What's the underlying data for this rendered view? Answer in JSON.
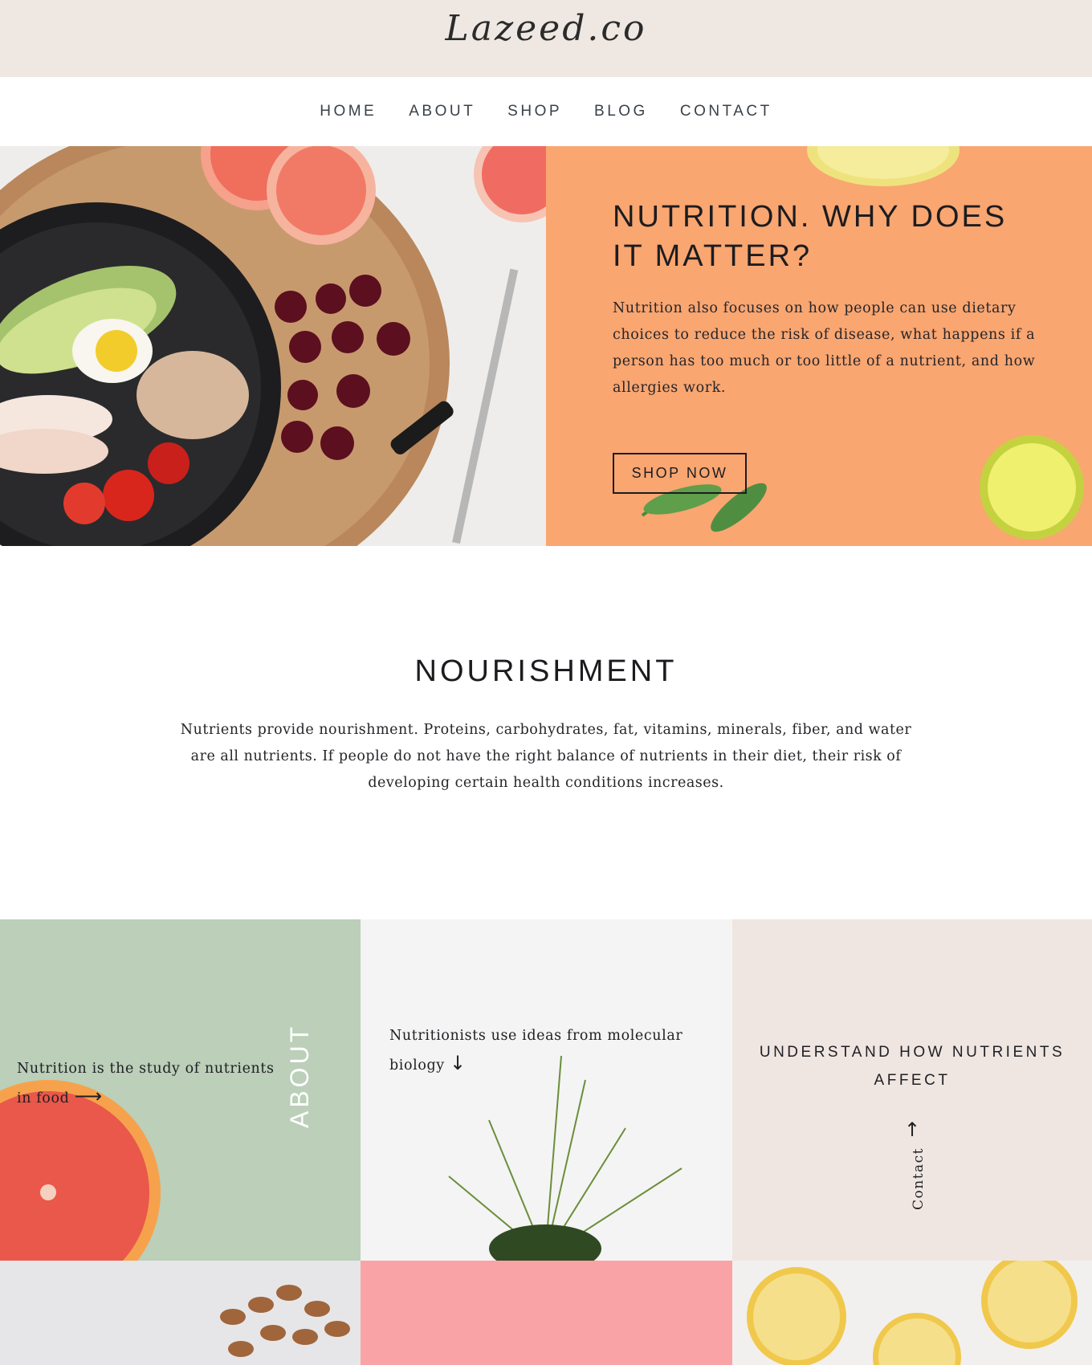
{
  "brand": {
    "logo": "Lazeed.co"
  },
  "nav": {
    "items": [
      "HOME",
      "ABOUT",
      "SHOP",
      "BLOG",
      "CONTACT"
    ]
  },
  "hero": {
    "title": "NUTRITION. WHY DOES IT MATTER?",
    "text": "Nutrition also focuses on how people can use dietary choices to reduce the risk of disease, what happens if a person has too much or too little of a nutrient, and how allergies work.",
    "button_label": "SHOP NOW",
    "panel_color": "#f9a671"
  },
  "nourishment": {
    "title": "NOURISHMENT",
    "text": "Nutrients provide nourishment. Proteins, carbohydrates, fat, vitamins, minerals, fiber, and water are all nutrients. If people do not have the right balance of nutrients in their diet, their risk of developing certain health conditions increases."
  },
  "tiles": {
    "about": {
      "text": "Nutrition is the study of nutrients in food",
      "vertical_label": "ABOUT",
      "arrow": "right-arrow-icon",
      "color": "#bbcfb9"
    },
    "molecular": {
      "text": "Nutritionists use ideas from molecular biology",
      "arrow": "down-arrow-icon"
    },
    "understand": {
      "heading": "UNDERSTAND HOW NUTRIENTS AFFECT",
      "link_label": "Contact",
      "arrow": "up-arrow-icon",
      "color": "#efe6e1"
    },
    "pink_color": "#f9a3a6"
  }
}
